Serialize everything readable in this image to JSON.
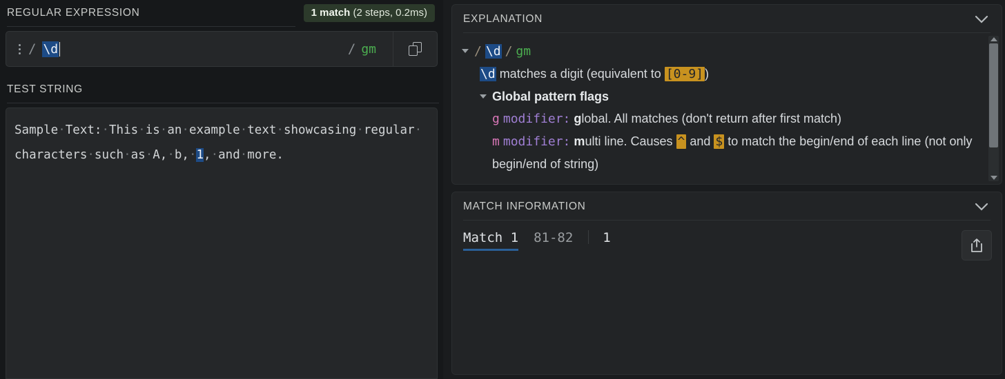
{
  "regex_section": {
    "title": "REGULAR EXPRESSION",
    "match_badge": {
      "count_label": "1 match",
      "detail": " (2 steps, 0.2ms)",
      "bg_color": "#2c3a2b"
    },
    "input": {
      "menu_icon": "kebab-menu-icon",
      "open_delimiter": "/",
      "pattern": "\\d",
      "close_delimiter": "/",
      "flags": "gm",
      "copy_icon": "copy-icon"
    }
  },
  "test_string_section": {
    "title": "TEST STRING",
    "content_plain": "Sample Text: This is an example text showcasing regular characters such as A, b, 1, and more.",
    "tokens": [
      {
        "t": "Sample",
        "k": "text"
      },
      {
        "t": "·",
        "k": "space"
      },
      {
        "t": "Text:",
        "k": "text"
      },
      {
        "t": "·",
        "k": "space"
      },
      {
        "t": "This",
        "k": "text"
      },
      {
        "t": "·",
        "k": "space"
      },
      {
        "t": "is",
        "k": "text"
      },
      {
        "t": "·",
        "k": "space"
      },
      {
        "t": "an",
        "k": "text"
      },
      {
        "t": "·",
        "k": "space"
      },
      {
        "t": "example",
        "k": "text"
      },
      {
        "t": "·",
        "k": "space"
      },
      {
        "t": "text",
        "k": "text"
      },
      {
        "t": "·",
        "k": "space"
      },
      {
        "t": "showcasing",
        "k": "text"
      },
      {
        "t": "·",
        "k": "space"
      },
      {
        "t": "regular",
        "k": "text"
      },
      {
        "t": "·",
        "k": "space"
      },
      {
        "t": "characters",
        "k": "text"
      },
      {
        "t": "·",
        "k": "space"
      },
      {
        "t": "such",
        "k": "text"
      },
      {
        "t": "·",
        "k": "space"
      },
      {
        "t": "as",
        "k": "text"
      },
      {
        "t": "·",
        "k": "space"
      },
      {
        "t": "A,",
        "k": "text"
      },
      {
        "t": "·",
        "k": "space"
      },
      {
        "t": "b,",
        "k": "text"
      },
      {
        "t": "·",
        "k": "space"
      },
      {
        "t": "1",
        "k": "match"
      },
      {
        "t": ",",
        "k": "text"
      },
      {
        "t": "·",
        "k": "space"
      },
      {
        "t": "and",
        "k": "text"
      },
      {
        "t": "·",
        "k": "space"
      },
      {
        "t": "more.",
        "k": "text"
      }
    ]
  },
  "explanation_panel": {
    "title": "EXPLANATION",
    "collapse_icon": "chevron-down-icon",
    "pattern_line": {
      "open_delimiter": "/",
      "pattern": "\\d",
      "close_delimiter": "/",
      "flags": "gm"
    },
    "digit_line": {
      "token": "\\d",
      "text_before": " matches a digit (equivalent to ",
      "highlight": "[0-9]",
      "text_after": ")"
    },
    "flags_group_title": "Global pattern flags",
    "flag_rows": [
      {
        "letter": "g",
        "keyword": "modifier:",
        "bold_first": "g",
        "description": "lobal. All matches (don't return after first match)"
      },
      {
        "letter": "m",
        "keyword": "modifier:",
        "bold_first": "m",
        "desc_part1": "ulti line. Causes ",
        "token1": "^",
        "desc_part2": " and ",
        "token2": "$",
        "desc_part3": " to match the begin/end of each line (not only begin/end of string)"
      }
    ],
    "scrollbar": {
      "up_icon": "scroll-up-arrow-icon",
      "down_icon": "scroll-down-arrow-icon"
    }
  },
  "match_information_panel": {
    "title": "MATCH INFORMATION",
    "collapse_icon": "chevron-down-icon",
    "export_icon": "export-icon",
    "rows": [
      {
        "label": "Match 1",
        "range": "81-82",
        "value": "1"
      }
    ]
  },
  "theme": {
    "background": "#16181a",
    "panel_bg": "#222426",
    "input_bg": "#252729",
    "accent_blue": "#1d4b86",
    "accent_green": "#4caf50",
    "accent_gold": "#c8921f",
    "underline_blue": "#2a6099"
  }
}
